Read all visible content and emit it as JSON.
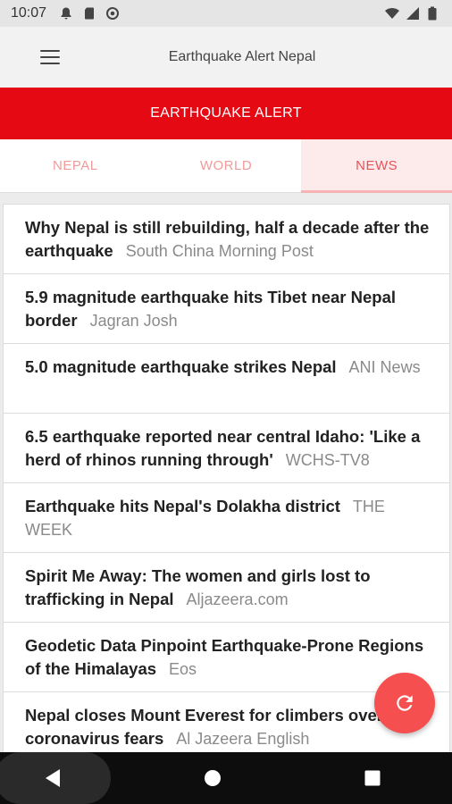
{
  "status_bar": {
    "time": "10:07",
    "left_icons": [
      "notification-bell-icon",
      "sd-card-icon",
      "at-sign-icon"
    ],
    "right_icons": [
      "wifi-icon",
      "signal-icon",
      "battery-icon"
    ]
  },
  "app_bar": {
    "title": "Earthquake Alert Nepal",
    "menu_icon": "hamburger-menu-icon"
  },
  "alert_banner": {
    "label": "EARTHQUAKE ALERT",
    "color": "#e50914"
  },
  "tabs": [
    {
      "label": "NEPAL",
      "active": false
    },
    {
      "label": "WORLD",
      "active": false
    },
    {
      "label": "NEWS",
      "active": true
    }
  ],
  "news": [
    {
      "headline": "Why Nepal is still rebuilding, half a decade after the earthquake",
      "source": "South China Morning Post"
    },
    {
      "headline": "5.9 magnitude earthquake hits Tibet near Nepal border",
      "source": "Jagran Josh"
    },
    {
      "headline": "5.0 magnitude earthquake strikes Nepal",
      "source": "ANI News"
    },
    {
      "headline": "6.5 earthquake reported near central Idaho: 'Like a herd of rhinos running through'",
      "source": "WCHS-TV8"
    },
    {
      "headline": "Earthquake hits Nepal's Dolakha district",
      "source": "THE WEEK"
    },
    {
      "headline": "Spirit Me Away: The women and girls lost to trafficking in Nepal",
      "source": "Aljazeera.com"
    },
    {
      "headline": "Geodetic Data Pinpoint Earthquake-Prone Regions of the Himalayas",
      "source": "Eos"
    },
    {
      "headline": "Nepal closes Mount Everest for climbers over coronavirus fears",
      "source": "Al Jazeera English"
    }
  ],
  "fab": {
    "icon": "refresh-icon",
    "color": "#f5504f"
  },
  "nav_bar": {
    "icons": [
      "back-icon",
      "home-icon",
      "recents-icon"
    ]
  }
}
